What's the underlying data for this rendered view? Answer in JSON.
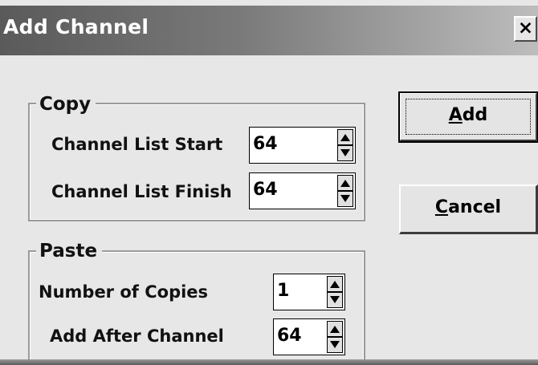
{
  "window": {
    "title": "Add Channel",
    "close_glyph": "×"
  },
  "copy_group": {
    "legend": "Copy",
    "start_label": "Channel List Start",
    "start_value": "64",
    "finish_label": "Channel List Finish",
    "finish_value": "64"
  },
  "paste_group": {
    "legend": "Paste",
    "copies_label": "Number of Copies",
    "copies_value": "1",
    "after_label": "Add After Channel",
    "after_value": "64"
  },
  "buttons": {
    "add_mnemonic": "A",
    "add_rest": "dd",
    "cancel_mnemonic": "C",
    "cancel_rest": "ancel"
  },
  "icons": {
    "close": "close-icon",
    "spin_up": "arrow-up-icon",
    "spin_down": "arrow-down-icon"
  }
}
